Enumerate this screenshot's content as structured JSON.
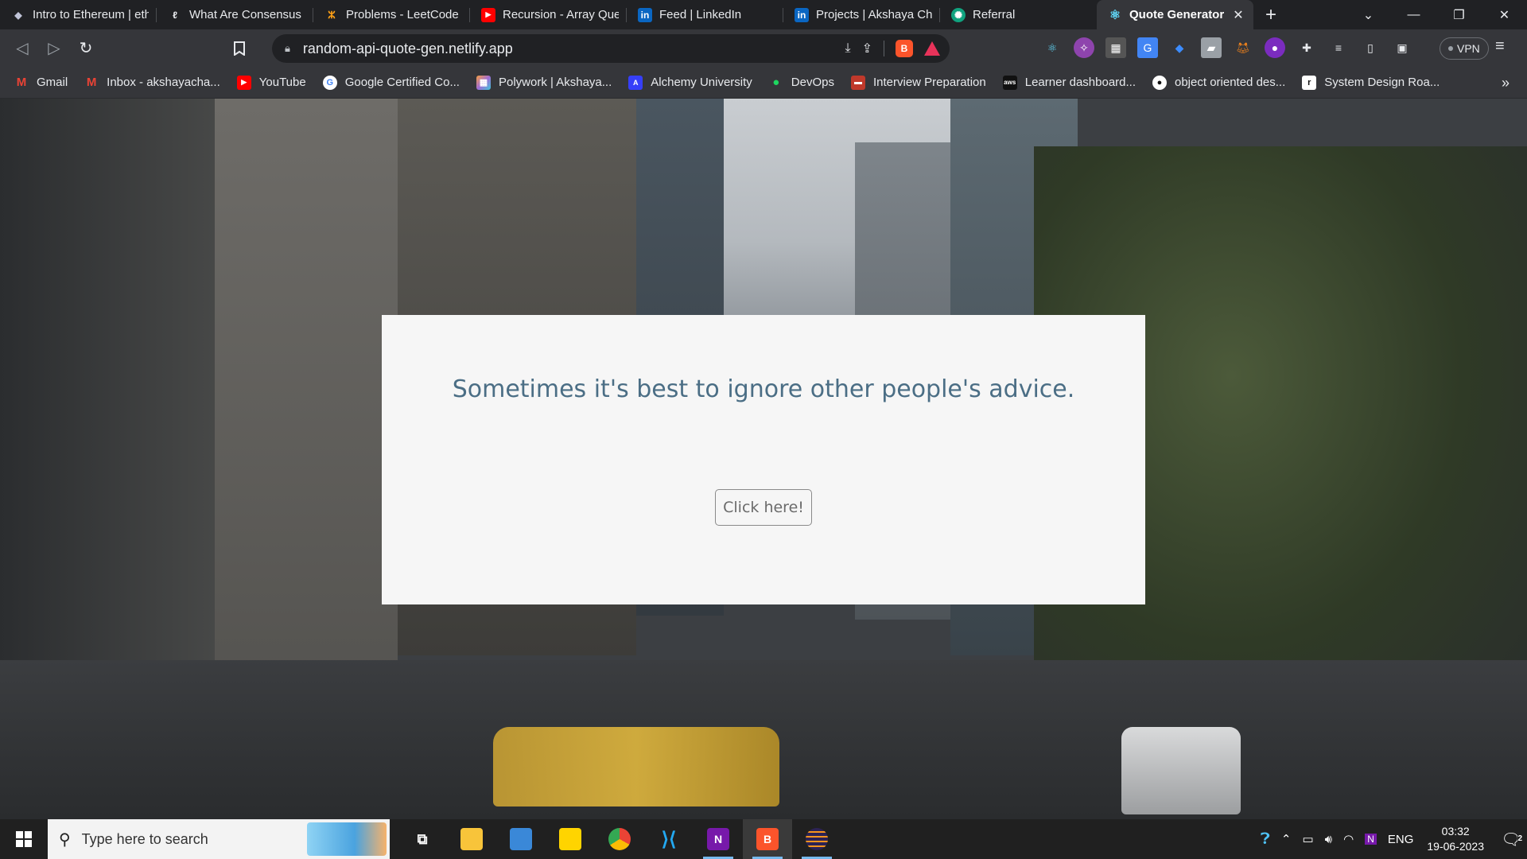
{
  "browser": {
    "tabs": [
      {
        "title": "Intro to Ethereum | eth",
        "favicon": "ethereum-icon",
        "color": "#8a92b2"
      },
      {
        "title": "What Are Consensus M",
        "favicon": "cursive-logo-icon",
        "color": "#e8eaed"
      },
      {
        "title": "Problems - LeetCode",
        "favicon": "leetcode-icon",
        "color": "#ffa116"
      },
      {
        "title": "Recursion - Array Ques",
        "favicon": "youtube-icon",
        "color": "#ff0000"
      },
      {
        "title": "Feed | LinkedIn",
        "favicon": "linkedin-icon",
        "color": "#0a66c2"
      },
      {
        "title": "Projects | Akshaya Char",
        "favicon": "linkedin-icon",
        "color": "#0a66c2"
      },
      {
        "title": "Referral",
        "favicon": "openai-icon",
        "color": "#10a37f"
      },
      {
        "title": "Quote Generator",
        "favicon": "react-icon",
        "color": "#61dafb",
        "active": true
      }
    ],
    "new_tab_glyph": "+",
    "address": "random-api-quote-gen.netlify.app",
    "vpn_label": "VPN",
    "bookmarks": [
      {
        "label": "Gmail",
        "icon": "gmail-icon",
        "color": "#ea4335"
      },
      {
        "label": "Inbox - akshayacha...",
        "icon": "gmail-icon",
        "color": "#ea4335"
      },
      {
        "label": "YouTube",
        "icon": "youtube-icon",
        "color": "#ff0000"
      },
      {
        "label": "Google Certified Co...",
        "icon": "google-icon",
        "color": "#ffffff"
      },
      {
        "label": "Polywork | Akshaya...",
        "icon": "polywork-icon",
        "color": "#a06cd5"
      },
      {
        "label": "Alchemy University",
        "icon": "alchemy-icon",
        "color": "#363ff9"
      },
      {
        "label": "DevOps",
        "icon": "devops-icon",
        "color": "#1ed760"
      },
      {
        "label": "Interview Preparation",
        "icon": "briefcase-icon",
        "color": "#c0392b"
      },
      {
        "label": "Learner dashboard...",
        "icon": "aws-icon",
        "color": "#232f3e"
      },
      {
        "label": "object oriented des...",
        "icon": "github-icon",
        "color": "#ffffff"
      },
      {
        "label": "System Design Roa...",
        "icon": "notion-icon",
        "color": "#ffffff"
      }
    ]
  },
  "page": {
    "quote": "Sometimes it's best to ignore other people's advice.",
    "button_label": "Click here!",
    "card_color": "#f6f6f6",
    "quote_color": "#4b6e85"
  },
  "taskbar": {
    "search_placeholder": "Type here to search",
    "language": "ENG",
    "time": "03:32",
    "date": "19-06-2023",
    "notification_count": "2"
  }
}
